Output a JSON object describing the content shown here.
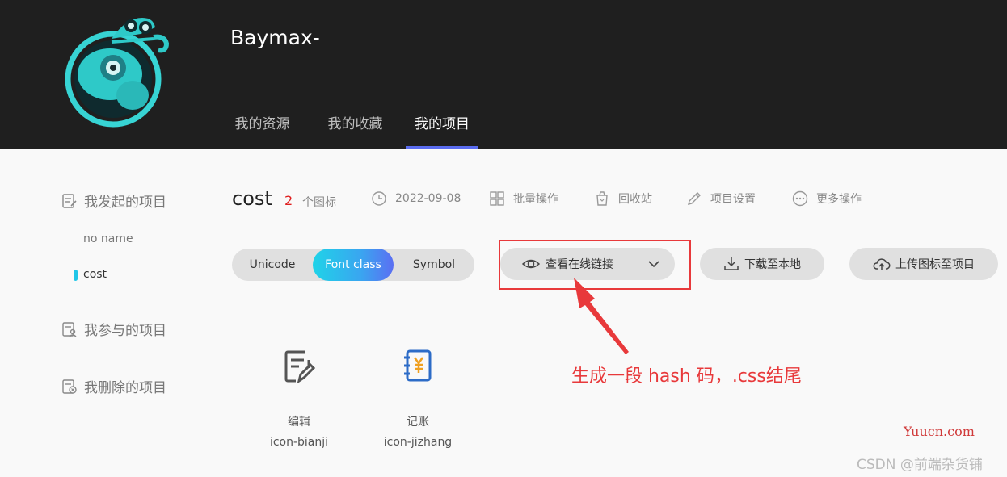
{
  "header": {
    "username": "Baymax-",
    "tabs": [
      {
        "label": "我的资源"
      },
      {
        "label": "我的收藏"
      },
      {
        "label": "我的项目"
      }
    ]
  },
  "sidebar": {
    "initiated_label": "我发起的项目",
    "sub_items": [
      {
        "label": "no name"
      },
      {
        "label": "cost"
      }
    ],
    "participated_label": "我参与的项目",
    "deleted_label": "我删除的项目"
  },
  "project": {
    "name": "cost",
    "icon_count": "2",
    "icon_count_label": "个图标",
    "date": "2022-09-08",
    "batch_label": "批量操作",
    "recycle_label": "回收站",
    "settings_label": "项目设置",
    "more_label": "更多操作"
  },
  "format_tabs": {
    "unicode": "Unicode",
    "font_class": "Font class",
    "symbol": "Symbol",
    "selected": "Font class"
  },
  "actions": {
    "view_link": "查看在线链接",
    "download": "下载至本地",
    "upload": "上传图标至项目"
  },
  "annotation": {
    "text": "生成一段 hash 码，.css结尾"
  },
  "icons": [
    {
      "name": "编辑",
      "class": "icon-bianji",
      "icon": "edit-icon"
    },
    {
      "name": "记账",
      "class": "icon-jizhang",
      "icon": "account-book-icon"
    }
  ],
  "watermarks": {
    "site": "Yuucn.com",
    "author": "CSDN @前端杂货铺"
  },
  "colors": {
    "header_bg": "#1f1f1f",
    "accent_gradient_start": "#1fd3e8",
    "accent_gradient_end": "#5b6ff2",
    "annotation_red": "#e8393b",
    "count_red": "#e02020"
  }
}
